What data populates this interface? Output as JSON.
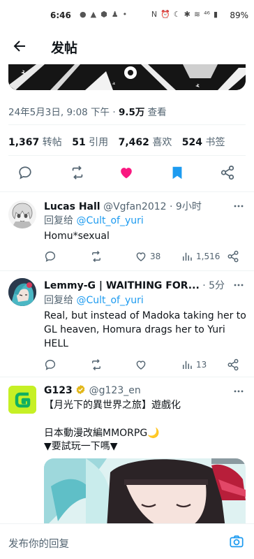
{
  "status_bar": {
    "time": "6:46",
    "battery": "89%",
    "left_icons": [
      "●",
      "▲",
      "⬢",
      "♟",
      "•"
    ],
    "right_icons": [
      "N",
      "⏰",
      "☾",
      "✱",
      "≋",
      "⁴⁶",
      "▮"
    ]
  },
  "header": {
    "title": "发帖",
    "back_icon": "arrow-left-icon"
  },
  "post_meta": {
    "date": "24年5月3日",
    "time": "9:08 下午",
    "separator": "·",
    "views": "9.5万",
    "views_label": "查看"
  },
  "post_stats": {
    "reposts": "1,367",
    "reposts_label": "转帖",
    "quotes": "51",
    "quotes_label": "引用",
    "likes": "7,462",
    "likes_label": "喜欢",
    "bookmarks": "524",
    "bookmarks_label": "书签"
  },
  "action_bar": {
    "icons": [
      "reply-icon",
      "repost-icon",
      "like-icon",
      "bookmark-icon",
      "share-icon"
    ],
    "colors": {
      "like": "#f91880",
      "bookmark": "#1d9bf0",
      "default": "#536471"
    }
  },
  "replies": [
    {
      "name": "Lucas Hall",
      "handle": "@Vgfan2012",
      "separator": "·",
      "time": "9小时",
      "reply_to_label": "回复给",
      "reply_to": "@Cult_of_yuri",
      "text": "Homu*sexual",
      "likes": "38",
      "views": "1,516"
    },
    {
      "name": "Lemmy-G | WAITHING FOR...",
      "handle": "",
      "separator": "·",
      "time": "5分",
      "reply_to_label": "回复给",
      "reply_to": "@Cult_of_yuri",
      "text": "Real, but instead of Madoka taking her to GL heaven, Homura drags her to Yuri HELL",
      "likes": "",
      "views": "13"
    }
  ],
  "ad": {
    "name": "G123",
    "handle": "@g123_en",
    "line1": "【月光下的異世界之旅】遊戲化",
    "line2": "日本動漫改編MMORPG🌙",
    "line3": "▼要試玩一下嗎▼",
    "logo_letter": "G",
    "logo_color": "#c6f025",
    "verified_color": "#e2b719"
  },
  "compose": {
    "placeholder": "发布你的回复"
  }
}
